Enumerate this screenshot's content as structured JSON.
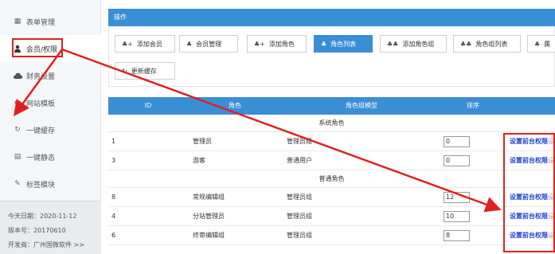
{
  "sidebar": {
    "items": [
      {
        "label": "表单管理",
        "icon": "table-icon"
      },
      {
        "label": "会员/权限",
        "icon": "user-icon"
      },
      {
        "label": "财务设置",
        "icon": "cloud-icon"
      },
      {
        "label": "网站模板",
        "icon": "template-icon"
      },
      {
        "label": "一键缓存",
        "icon": "refresh-icon"
      },
      {
        "label": "一键静态",
        "icon": "static-icon"
      },
      {
        "label": "标签模块",
        "icon": "tag-icon"
      }
    ],
    "info": {
      "date": "今天日期：2020-11-12",
      "version": "版本号：20170610",
      "developer": "开发商：广州国微软件 >>"
    }
  },
  "header": {
    "title": "操作"
  },
  "toolbar": {
    "buttons": [
      {
        "label": "添加会员",
        "icon": "user-add-icon"
      },
      {
        "label": "会员管理",
        "icon": "user-icon"
      },
      {
        "label": "添加角色",
        "icon": "user-add-icon"
      },
      {
        "label": "角色列表",
        "icon": "user-icon"
      },
      {
        "label": "添加角色组",
        "icon": "users-icon"
      },
      {
        "label": "角色组列表",
        "icon": "users-icon"
      },
      {
        "label": "属",
        "icon": "user-icon"
      },
      {
        "label": "更新缓存",
        "icon": "refresh-icon"
      }
    ]
  },
  "table": {
    "columns": [
      "ID",
      "角色",
      "角色组模型",
      "排序",
      ""
    ],
    "groups": [
      {
        "name": "系统角色",
        "rows": [
          {
            "id": "1",
            "role": "管理员",
            "model": "管理员组",
            "sort": "0",
            "action": "设置前台权限",
            "more": "设"
          },
          {
            "id": "3",
            "role": "游客",
            "model": "普通用户",
            "sort": "0",
            "action": "设置前台权限",
            "more": "设"
          }
        ]
      },
      {
        "name": "普通角色",
        "rows": [
          {
            "id": "8",
            "role": "常规编辑组",
            "model": "管理员组",
            "sort": "12",
            "action": "设置前台权限",
            "more": "设"
          },
          {
            "id": "4",
            "role": "分站管理员",
            "model": "管理员组",
            "sort": "10",
            "action": "设置前台权限",
            "more": "设"
          },
          {
            "id": "6",
            "role": "终审编辑组",
            "model": "管理员组",
            "sort": "8",
            "action": "设置前台权限",
            "more": "设"
          }
        ]
      }
    ]
  },
  "colors": {
    "accent": "#3a8ed3",
    "annotation": "#e02020",
    "link": "#1a3fd8"
  }
}
